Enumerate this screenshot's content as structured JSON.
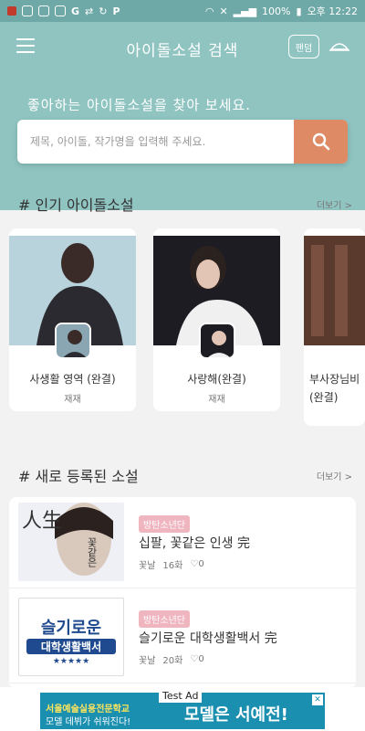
{
  "status_bar": {
    "battery": "100%",
    "time": "오후 12:22"
  },
  "app": {
    "title": "아이돌소설 검색",
    "fandom_button": "팬덤",
    "hat_icon": "hat-icon",
    "menu_icon": "menu-icon"
  },
  "hero": {
    "subtitle": "좋아하는 아이돌소설을 찾아 보세요."
  },
  "search": {
    "placeholder": "제목, 아이돌, 작가명을 입력해 주세요.",
    "icon": "search-icon"
  },
  "popular": {
    "title": "# 인기 아이돌소설",
    "more": "더보기 >",
    "cards": [
      {
        "title": "사생활 영역 (완결)",
        "author": "재재"
      },
      {
        "title": "사랑해(완결)",
        "author": "재재"
      },
      {
        "title": "부사장님비",
        "title2": "(완결)",
        "author": ""
      }
    ]
  },
  "new": {
    "title": "# 새로 등록된 소설",
    "more": "더보기 >",
    "rows": [
      {
        "badge": "방탄소년단",
        "title": "십팔, 꽃같은 인생 完",
        "author": "꽃날",
        "episodes": "16화",
        "likes": "0"
      },
      {
        "badge": "방탄소년단",
        "title": "슬기로운 대학생활백서 完",
        "author": "꽃날",
        "episodes": "20화",
        "likes": "0"
      }
    ]
  },
  "ad": {
    "label": "Test Ad",
    "line1": "서울예술실용전문학교",
    "line2": "모델 데뷔가 쉬워진다!",
    "headline": "모델은 서예전!",
    "thumb2_line1": "슬기로운",
    "thumb2_line2": "대학생활백서",
    "thumb1_char": "人生",
    "thumb1_text": "꽃같은"
  }
}
